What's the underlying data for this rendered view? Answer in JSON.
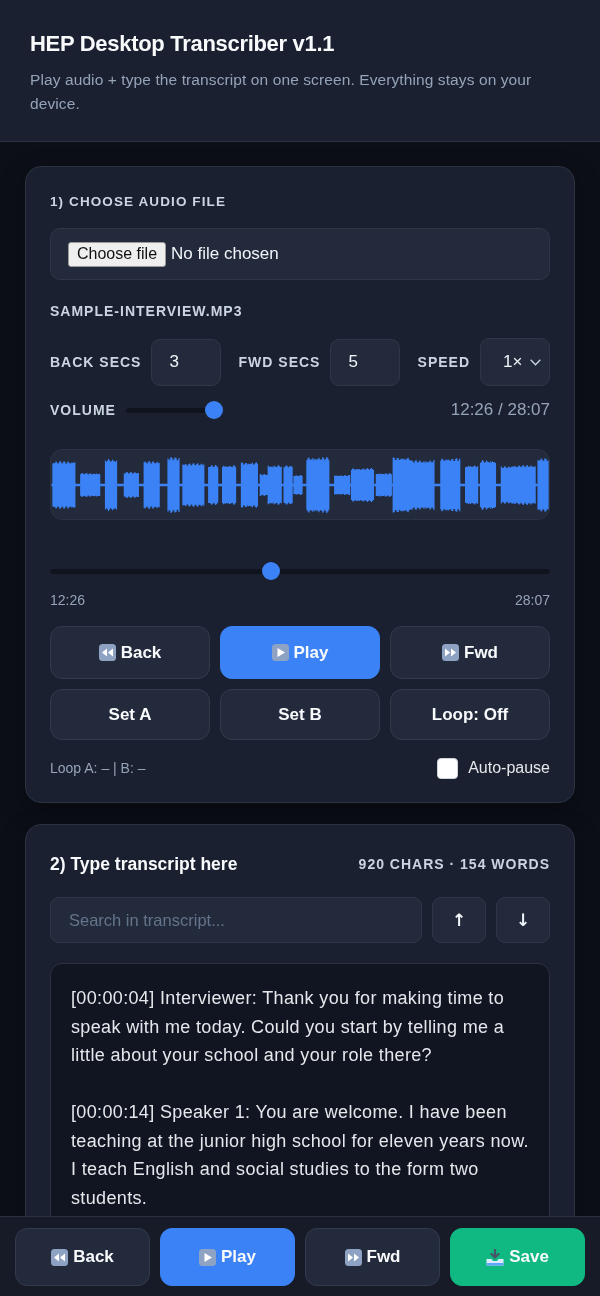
{
  "header": {
    "title": "HEP Desktop Transcriber v1.1",
    "subtitle": "Play audio + type the transcript on one screen. Everything stays on your device."
  },
  "audio_card": {
    "heading": "1) CHOOSE AUDIO FILE",
    "file_input": {
      "button": "Choose file",
      "status": "No file chosen"
    },
    "file_name": "SAMPLE-INTERVIEW.MP3",
    "settings": [
      {
        "label": "BACK SECS",
        "value": "3",
        "kind": "number"
      },
      {
        "label": "FWD SECS",
        "value": "5",
        "kind": "number"
      },
      {
        "label": "SPEED",
        "value": "1×",
        "kind": "select"
      }
    ],
    "volume": {
      "label": "VOLUME",
      "level": 1
    },
    "time_readout": "12:26 / 28:07",
    "seek": {
      "level": 0.44,
      "current": "12:26",
      "total": "28:07"
    },
    "transport_buttons": [
      {
        "label": "Back",
        "kind": "back"
      },
      {
        "label": "Play",
        "kind": "play"
      },
      {
        "label": "Fwd",
        "kind": "forward"
      }
    ],
    "loop_buttons": [
      {
        "label": "Set A"
      },
      {
        "label": "Set B"
      },
      {
        "label": "Loop: Off"
      }
    ],
    "loop_status": "Loop A: – | B: –",
    "auto_pause": {
      "label": "Auto-pause",
      "checked": false
    }
  },
  "transcript_card": {
    "heading": "2) Type transcript here",
    "stats": "920 CHARS · 154 WORDS",
    "search": {
      "placeholder": "Search in transcript..."
    },
    "nav_buttons": [
      {
        "label": "↑"
      },
      {
        "label": "↓"
      }
    ],
    "paragraphs": [
      "[00:00:04] Interviewer: Thank you for making time to speak with me today. Could you start by telling me a little about your school and your role there?",
      "[00:00:14] Speaker 1: You are welcome. I have been teaching at the junior high school for eleven years now. I teach English and social studies to the form two students."
    ]
  },
  "bottom_bar": [
    {
      "label": "Back",
      "kind": "back"
    },
    {
      "label": "Play",
      "kind": "play"
    },
    {
      "label": "Fwd",
      "kind": "forward"
    },
    {
      "label": "Save",
      "kind": "save"
    }
  ]
}
